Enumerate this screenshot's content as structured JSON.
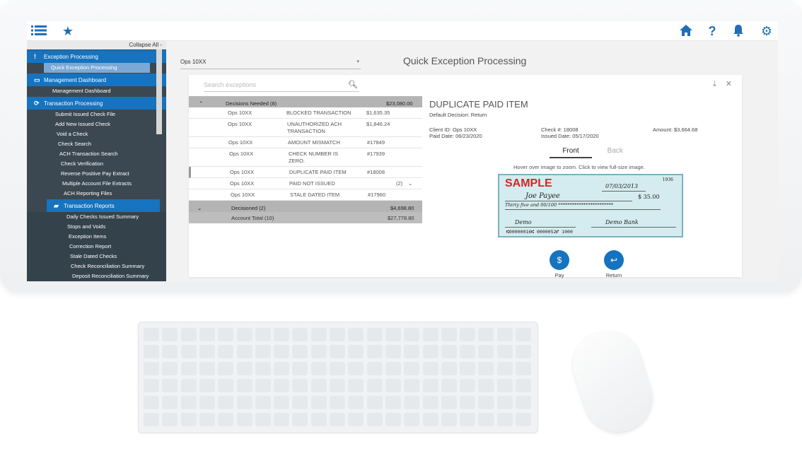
{
  "header": {
    "icons": [
      "list-icon",
      "star-icon",
      "home-icon",
      "help-icon",
      "bell-icon",
      "gear-icon"
    ],
    "accent": "#1e6fb8"
  },
  "sidebar": {
    "collapse_label": "Collapse All -",
    "sections": [
      {
        "label": "Exception Processing",
        "icon": "!",
        "items": [
          "Quick Exception Processing"
        ]
      },
      {
        "label": "Management Dashboard",
        "icon": "▭",
        "items": [
          "Management Dashboard"
        ]
      },
      {
        "label": "Transaction Processing",
        "icon": "⟳",
        "items": [
          "Submit Issued Check File",
          "Add New Issued Check",
          "Void a Check",
          "Check Search",
          "ACH Transaction Search",
          "Check Verification",
          "Reverse Positive Pay Extract",
          "Multiple Account File Extracts",
          "ACH Reporting Files"
        ]
      },
      {
        "label": "Transaction Reports",
        "icon": "▰",
        "items": [
          "Daily Checks Issued Summary",
          "Stops and Voids",
          "Exception Items",
          "Correction Report",
          "Stale Dated Checks",
          "Check Reconciliation Summary",
          "Deposit Reconciliation Summary"
        ]
      }
    ]
  },
  "main": {
    "ops_select": "Ops 10XX",
    "title": "Quick Exception Processing",
    "search_placeholder": "Search exceptions"
  },
  "list": {
    "needed_label": "Decisions Needed (8)",
    "needed_total": "$23,080.00",
    "rows": [
      {
        "client": "Ops 10XX",
        "type": "BLOCKED TRANSACTION",
        "value": "$1,635.35"
      },
      {
        "client": "Ops 10XX",
        "type": "UNAUTHORIZED ACH TRANSACTION",
        "value": "$1,846.24"
      },
      {
        "client": "Ops 10XX",
        "type": "AMOUNT MISMATCH",
        "value": "#17849"
      },
      {
        "client": "Ops 10XX",
        "type": "CHECK NUMBER IS ZERO.",
        "value": "#17939"
      },
      {
        "client": "Ops 10XX",
        "type": "DUPLICATE PAID ITEM",
        "value": "#18008"
      },
      {
        "client": "Ops 10XX",
        "type": "PAID NOT ISSUED",
        "value": "(2)"
      },
      {
        "client": "Ops 10XX",
        "type": "STALE DATED ITEM",
        "value": "#17960"
      }
    ],
    "decisioned_label": "Decisioned (2)",
    "decisioned_total": "$4,698.80",
    "account_total_label": "Account Total (10)",
    "account_total": "$27,778.80"
  },
  "detail": {
    "title": "DUPLICATE PAID ITEM",
    "default_decision": "Default Decision:  Return",
    "client_id": "Client ID:  Ops 10XX",
    "paid_date": "Paid Date:  06/23/2020",
    "check_no": "Check #:  18008",
    "issued_date": "Issued Date:  05/17/2020",
    "amount": "Amount:  $3,664.68",
    "tab_front": "Front",
    "tab_back": "Back",
    "hint": "Hover over image to zoom. Click to view full-size image.",
    "check": {
      "sample": "SAMPLE",
      "number": "1936",
      "date": "07/03/2013",
      "payee": "Joe Payee",
      "amount": "$ 35.00",
      "words": "Thirty five and 00/100 ************************",
      "memo": "Demo",
      "bank": "Demo Bank",
      "micr": "⑆00000016⑆  0000052⑈  1000"
    },
    "pay_label": "Pay",
    "return_label": "Return"
  }
}
